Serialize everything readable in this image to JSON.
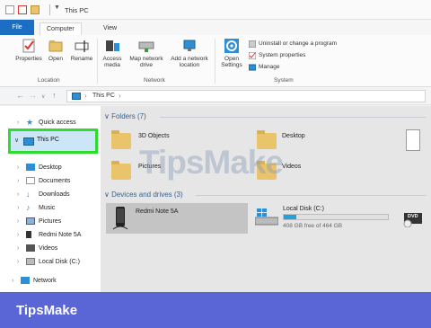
{
  "window": {
    "title": "This PC"
  },
  "tabs": {
    "file": "File",
    "computer": "Computer",
    "view": "View"
  },
  "ribbon": {
    "location": {
      "group": "Location",
      "properties": "Properties",
      "open": "Open",
      "rename": "Rename"
    },
    "network": {
      "group": "Network",
      "access_media": "Access media",
      "map_drive": "Map network drive",
      "add_location": "Add a network location"
    },
    "system": {
      "group": "System",
      "open_settings": "Open Settings",
      "uninstall": "Uninstall or change a program",
      "system_properties": "System properties",
      "manage": "Manage"
    }
  },
  "address": {
    "path": "This PC"
  },
  "nav": {
    "quick_access": "Quick access",
    "this_pc": "This PC",
    "items": [
      "Desktop",
      "Documents",
      "Downloads",
      "Music",
      "Pictures",
      "Redmi Note 5A",
      "Videos",
      "Local Disk (C:)"
    ],
    "network": "Network"
  },
  "content": {
    "folders_header": "Folders (7)",
    "folders": [
      "3D Objects",
      "Desktop",
      "Pictures",
      "Videos"
    ],
    "devices_header": "Devices and drives (3)",
    "devices": {
      "redmi": {
        "name": "Redmi Note 5A"
      },
      "local": {
        "name": "Local Disk (C:)",
        "free_text": "408 GB free of 464 GB",
        "used_fraction": 0.12
      },
      "dvd": {
        "label": "DVD"
      }
    }
  },
  "watermark": "TipsMake",
  "brand": "TipsMake",
  "colors": {
    "background": "#5b66d6",
    "accent": "#1b6ec2",
    "highlight": "#2ddc2d"
  }
}
